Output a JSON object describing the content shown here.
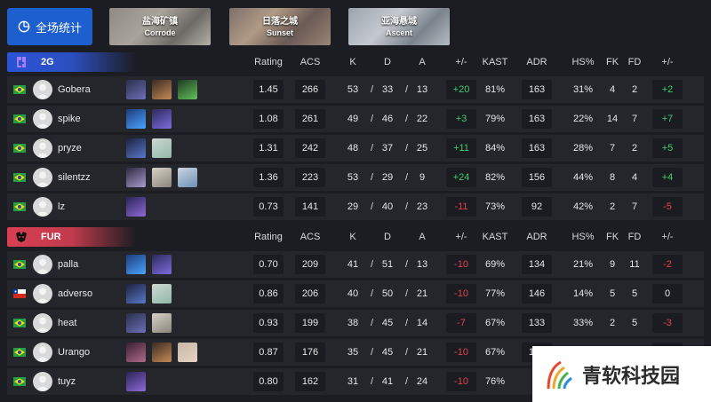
{
  "top": {
    "overall_label": "全场统计",
    "maps": [
      {
        "cn": "盐海矿镇",
        "en": "Corrode"
      },
      {
        "cn": "日落之城",
        "en": "Sunset"
      },
      {
        "cn": "亚海悬城",
        "en": "Ascent"
      }
    ]
  },
  "columns": [
    "Rating",
    "ACS",
    "K",
    "D",
    "A",
    "+/-",
    "KAST",
    "ADR",
    "HS%",
    "FK",
    "FD",
    "+/-"
  ],
  "teams": [
    {
      "name": "2G",
      "color": "#2a54d6",
      "players": [
        {
          "name": "Gobera",
          "country": "BR",
          "rating": "1.45",
          "acs": "266",
          "k": "53",
          "d": "33",
          "a": "13",
          "kd_diff": "+20",
          "kast": "81%",
          "adr": "163",
          "hs": "31%",
          "fk": "4",
          "fd": "2",
          "fk_diff": "+2",
          "agents": [
            "omen",
            "sova",
            "viper"
          ]
        },
        {
          "name": "spike",
          "country": "BR",
          "rating": "1.08",
          "acs": "261",
          "k": "49",
          "d": "46",
          "a": "22",
          "kd_diff": "+3",
          "kast": "79%",
          "adr": "163",
          "hs": "22%",
          "fk": "14",
          "fd": "7",
          "fk_diff": "+7",
          "agents": [
            "neon",
            "iso"
          ]
        },
        {
          "name": "pryze",
          "country": "BR",
          "rating": "1.31",
          "acs": "242",
          "k": "48",
          "d": "37",
          "a": "25",
          "kd_diff": "+11",
          "kast": "84%",
          "adr": "163",
          "hs": "28%",
          "fk": "7",
          "fd": "2",
          "fk_diff": "+5",
          "agents": [
            "yoru",
            "sage"
          ]
        },
        {
          "name": "silentzz",
          "country": "BR",
          "rating": "1.36",
          "acs": "223",
          "k": "53",
          "d": "29",
          "a": "9",
          "kd_diff": "+24",
          "kast": "82%",
          "adr": "156",
          "hs": "44%",
          "fk": "8",
          "fd": "4",
          "fk_diff": "+4",
          "agents": [
            "vyse",
            "cypher",
            "jett"
          ]
        },
        {
          "name": "lz",
          "country": "BR",
          "rating": "0.73",
          "acs": "141",
          "k": "29",
          "d": "40",
          "a": "23",
          "kd_diff": "-11",
          "kast": "73%",
          "adr": "92",
          "hs": "42%",
          "fk": "2",
          "fd": "7",
          "fk_diff": "-5",
          "agents": [
            "clove"
          ]
        }
      ]
    },
    {
      "name": "FUR",
      "color": "#d93e52",
      "players": [
        {
          "name": "palla",
          "country": "BR",
          "rating": "0.70",
          "acs": "209",
          "k": "41",
          "d": "51",
          "a": "13",
          "kd_diff": "-10",
          "kast": "69%",
          "adr": "134",
          "hs": "21%",
          "fk": "9",
          "fd": "11",
          "fk_diff": "-2",
          "agents": [
            "neon",
            "iso"
          ]
        },
        {
          "name": "adverso",
          "country": "CL",
          "rating": "0.86",
          "acs": "206",
          "k": "40",
          "d": "50",
          "a": "21",
          "kd_diff": "-10",
          "kast": "77%",
          "adr": "146",
          "hs": "14%",
          "fk": "5",
          "fd": "5",
          "fk_diff": "0",
          "agents": [
            "yoru",
            "sage"
          ]
        },
        {
          "name": "heat",
          "country": "BR",
          "rating": "0.93",
          "acs": "199",
          "k": "38",
          "d": "45",
          "a": "14",
          "kd_diff": "-7",
          "kast": "67%",
          "adr": "133",
          "hs": "33%",
          "fk": "2",
          "fd": "5",
          "fk_diff": "-3",
          "agents": [
            "omen",
            "cypher"
          ]
        },
        {
          "name": "Urango",
          "country": "BR",
          "rating": "0.87",
          "acs": "176",
          "k": "35",
          "d": "45",
          "a": "21",
          "kd_diff": "-10",
          "kast": "67%",
          "adr": "106",
          "hs": "35%",
          "fk": "1",
          "fd": "8",
          "fk_diff": "-7",
          "agents": [
            "fade",
            "sova",
            "tejo"
          ]
        },
        {
          "name": "tuyz",
          "country": "BR",
          "rating": "0.80",
          "acs": "162",
          "k": "31",
          "d": "41",
          "a": "24",
          "kd_diff": "-10",
          "kast": "76%",
          "adr": "",
          "hs": "",
          "fk": "",
          "fd": "",
          "fk_diff": "",
          "agents": [
            "clove"
          ]
        }
      ]
    }
  ],
  "watermark": {
    "text": "青软科技园"
  },
  "colors": {
    "positive": "#3ecf6a",
    "negative": "#e2434f",
    "accent": "#1d5fcf"
  }
}
